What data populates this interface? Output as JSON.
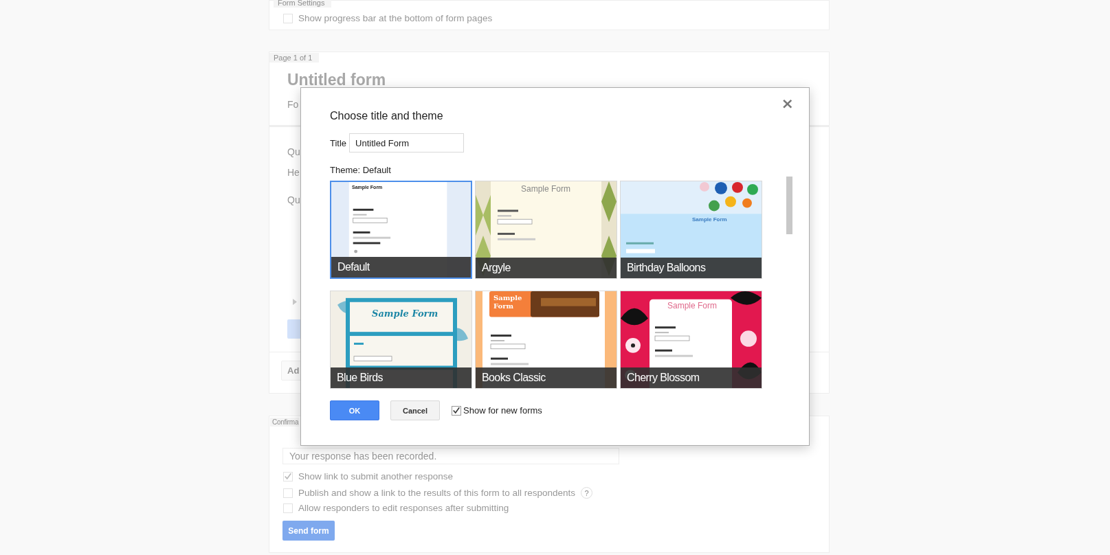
{
  "form_settings": {
    "tab": "Form Settings",
    "options": [
      {
        "label": "Show progress bar at the bottom of form pages",
        "checked": false
      }
    ]
  },
  "page": {
    "tab": "Page 1 of 1",
    "title": "Untitled form",
    "description": "Fo"
  },
  "question": {
    "labels": [
      "Qu",
      "He",
      "Qu"
    ]
  },
  "add_item": {
    "label": "Ad"
  },
  "confirmation": {
    "tab": "Confirma",
    "message": "Your response has been recorded.",
    "options": [
      {
        "label": "Show link to submit another response",
        "checked": true
      },
      {
        "label": "Publish and show a link to the results of this form to all respondents",
        "checked": false,
        "help": "?"
      },
      {
        "label": "Allow responders to edit responses after submitting",
        "checked": false
      }
    ],
    "send": "Send form"
  },
  "dialog": {
    "title": "Choose title and theme",
    "close": "×",
    "title_label": "Title",
    "title_value": "Untitled Form",
    "theme_label": "Theme: Default",
    "themes": [
      {
        "name": "Default",
        "kind": "default",
        "sample": "Sample Form",
        "selected": true
      },
      {
        "name": "Argyle",
        "kind": "argyle",
        "sample": "Sample Form",
        "selected": false
      },
      {
        "name": "Birthday Balloons",
        "kind": "balloons",
        "sample": "Sample Form",
        "selected": false
      },
      {
        "name": "Blue Birds",
        "kind": "birds",
        "sample": "Sample Form",
        "selected": false
      },
      {
        "name": "Books Classic",
        "kind": "books",
        "sample": "Sample Form",
        "selected": false
      },
      {
        "name": "Cherry Blossom",
        "kind": "blossom",
        "sample": "Sample Form",
        "selected": false
      }
    ],
    "ok": "OK",
    "cancel": "Cancel",
    "show_option": {
      "label": "Show for new forms",
      "checked": true
    }
  }
}
